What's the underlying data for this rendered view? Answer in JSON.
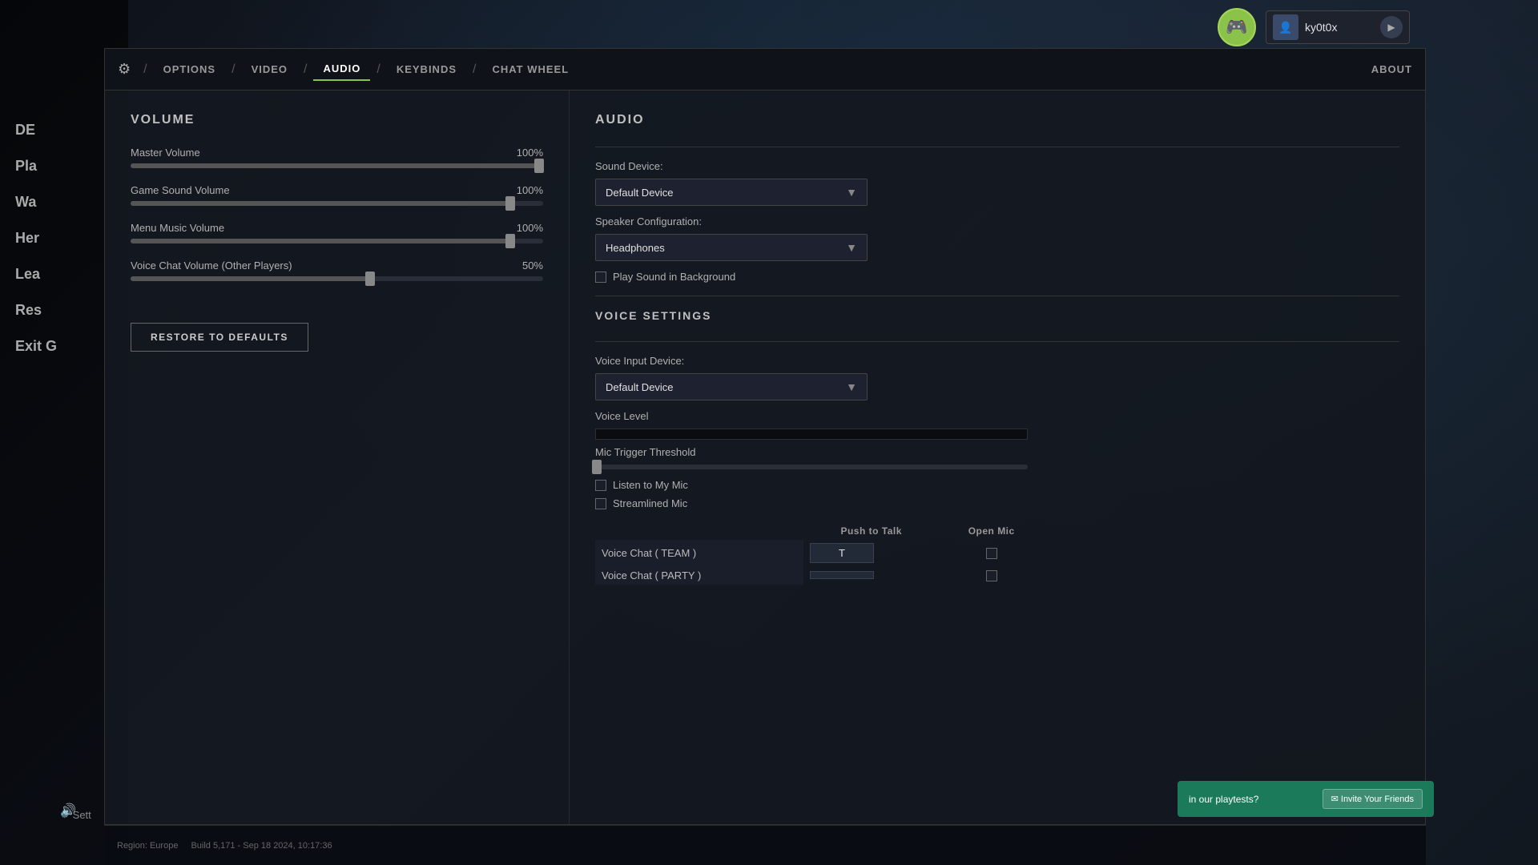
{
  "nav": {
    "gear_icon": "⚙",
    "tabs": [
      {
        "label": "OPTIONS",
        "active": false
      },
      {
        "label": "VIDEO",
        "active": false
      },
      {
        "label": "AUDIO",
        "active": true
      },
      {
        "label": "KEYBINDS",
        "active": false
      },
      {
        "label": "CHAT WHEEL",
        "active": false
      }
    ],
    "about_label": "ABOUT"
  },
  "topbar": {
    "avatar_icon": "🎮",
    "username": "ky0t0x",
    "play_icon": "▶"
  },
  "volume": {
    "title": "VOLUME",
    "sliders": [
      {
        "label": "Master Volume",
        "value": "100%",
        "fill_pct": 100,
        "thumb_pct": 99
      },
      {
        "label": "Game Sound Volume",
        "value": "100%",
        "fill_pct": 93,
        "thumb_pct": 92
      },
      {
        "label": "Menu Music Volume",
        "value": "100%",
        "fill_pct": 93,
        "thumb_pct": 92
      },
      {
        "label": "Voice Chat Volume (Other Players)",
        "value": "50%",
        "fill_pct": 58,
        "thumb_pct": 58
      }
    ],
    "restore_button": "RESTORE TO DEFAULTS"
  },
  "audio": {
    "title": "AUDIO",
    "sound_device_label": "Sound Device:",
    "sound_device_selected": "Default Device",
    "speaker_config_label": "Speaker Configuration:",
    "speaker_config_selected": "Headphones",
    "play_sound_bg_label": "Play Sound in Background",
    "play_sound_bg_checked": false,
    "voice_settings_title": "VOICE SETTINGS",
    "voice_input_device_label": "Voice Input Device:",
    "voice_input_selected": "Default Device",
    "voice_level_label": "Voice Level",
    "mic_trigger_label": "Mic Trigger Threshold",
    "listen_to_mic_label": "Listen to My Mic",
    "listen_to_mic_checked": false,
    "streamlined_mic_label": "Streamlined Mic",
    "streamlined_mic_checked": false,
    "voice_table": {
      "col_push_to_talk": "Push to Talk",
      "col_open_mic": "Open Mic",
      "rows": [
        {
          "label": "Voice Chat ( TEAM )",
          "push_key": "T",
          "open_mic": false
        },
        {
          "label": "Voice Chat ( PARTY )",
          "push_key": "",
          "open_mic": false
        }
      ]
    }
  },
  "bottom": {
    "region": "Region: Europe",
    "build": "Build 5,171 - Sep 18 2024, 10:17:36"
  },
  "left_menu": {
    "items": [
      "DE",
      "Pla",
      "Wa",
      "Her",
      "Lea",
      "Res",
      "Exit G"
    ]
  },
  "settings_label": "Sett",
  "invite_banner": {
    "text": "in our playtests?",
    "button": "✉ Invite Your Friends"
  }
}
